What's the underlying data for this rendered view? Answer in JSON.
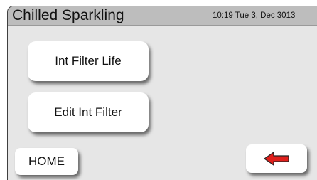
{
  "header": {
    "title": "Chilled Sparkling",
    "datetime": "10:19 Tue 3, Dec 3013"
  },
  "menu": {
    "filter_life_label": "Int Filter Life",
    "edit_filter_label": "Edit Int Filter"
  },
  "footer": {
    "home_label": "HOME",
    "back_icon": "left-arrow-icon",
    "back_icon_color": "#e0201c"
  },
  "colors": {
    "screen_background": "#e6e6e6",
    "header_background": "#bdbdbd",
    "button_background": "#ffffff"
  }
}
